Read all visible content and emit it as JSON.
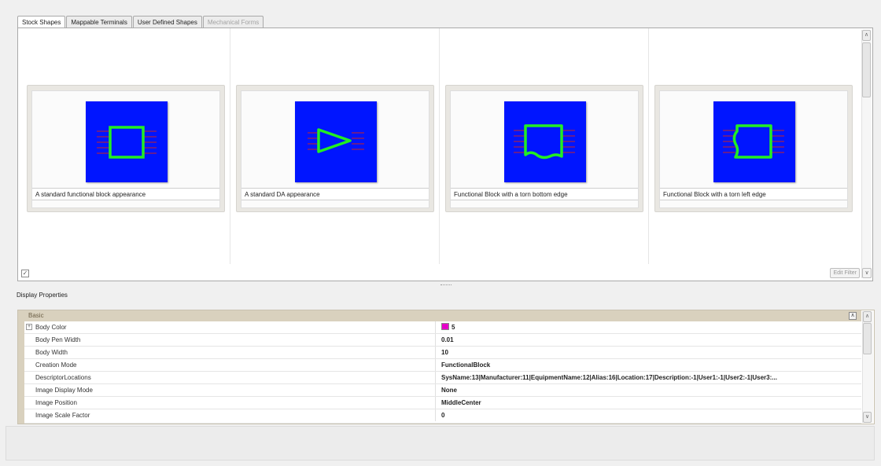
{
  "tabs": [
    {
      "label": "Stock Shapes"
    },
    {
      "label": "Mappable Terminals"
    },
    {
      "label": "User Defined Shapes"
    },
    {
      "label": "Mechanical Forms"
    }
  ],
  "shapes": [
    {
      "caption": "A standard functional block appearance",
      "icon": "functional-block-icon"
    },
    {
      "caption": "A standard DA appearance",
      "icon": "da-triangle-icon"
    },
    {
      "caption": "Functional Block with a torn bottom edge",
      "icon": "torn-bottom-block-icon"
    },
    {
      "caption": "Functional Block with a torn left edge",
      "icon": "torn-left-block-icon"
    }
  ],
  "gallery": {
    "edit_filter_label": "Edit Filter",
    "check_icon": "✓",
    "dropdown_icon": "∨",
    "scroll_up_icon": "∧"
  },
  "properties": {
    "title": "Display Properties",
    "category": "Basic",
    "collapse_icon": "∧",
    "rows": [
      {
        "name": "Body Color",
        "value": "5",
        "swatch": "#e600c8",
        "expandable": true
      },
      {
        "name": "Body Pen Width",
        "value": "0.01"
      },
      {
        "name": "Body Width",
        "value": "10"
      },
      {
        "name": "Creation Mode",
        "value": "FunctionalBlock"
      },
      {
        "name": "DescriptorLocations",
        "value": "SysName:13|Manufacturer:11|EquipmentName:12|Alias:16|Location:17|Description:-1|User1:-1|User2:-1|User3:..."
      },
      {
        "name": "Image Display Mode",
        "value": "None"
      },
      {
        "name": "Image Position",
        "value": "MiddleCenter"
      },
      {
        "name": "Image Scale Factor",
        "value": "0"
      }
    ]
  },
  "colors": {
    "thumb_bg": "#0015ff",
    "shape_stroke": "#22ee22",
    "pin_color": "#cc2222",
    "category_bg": "#d9d1be"
  }
}
